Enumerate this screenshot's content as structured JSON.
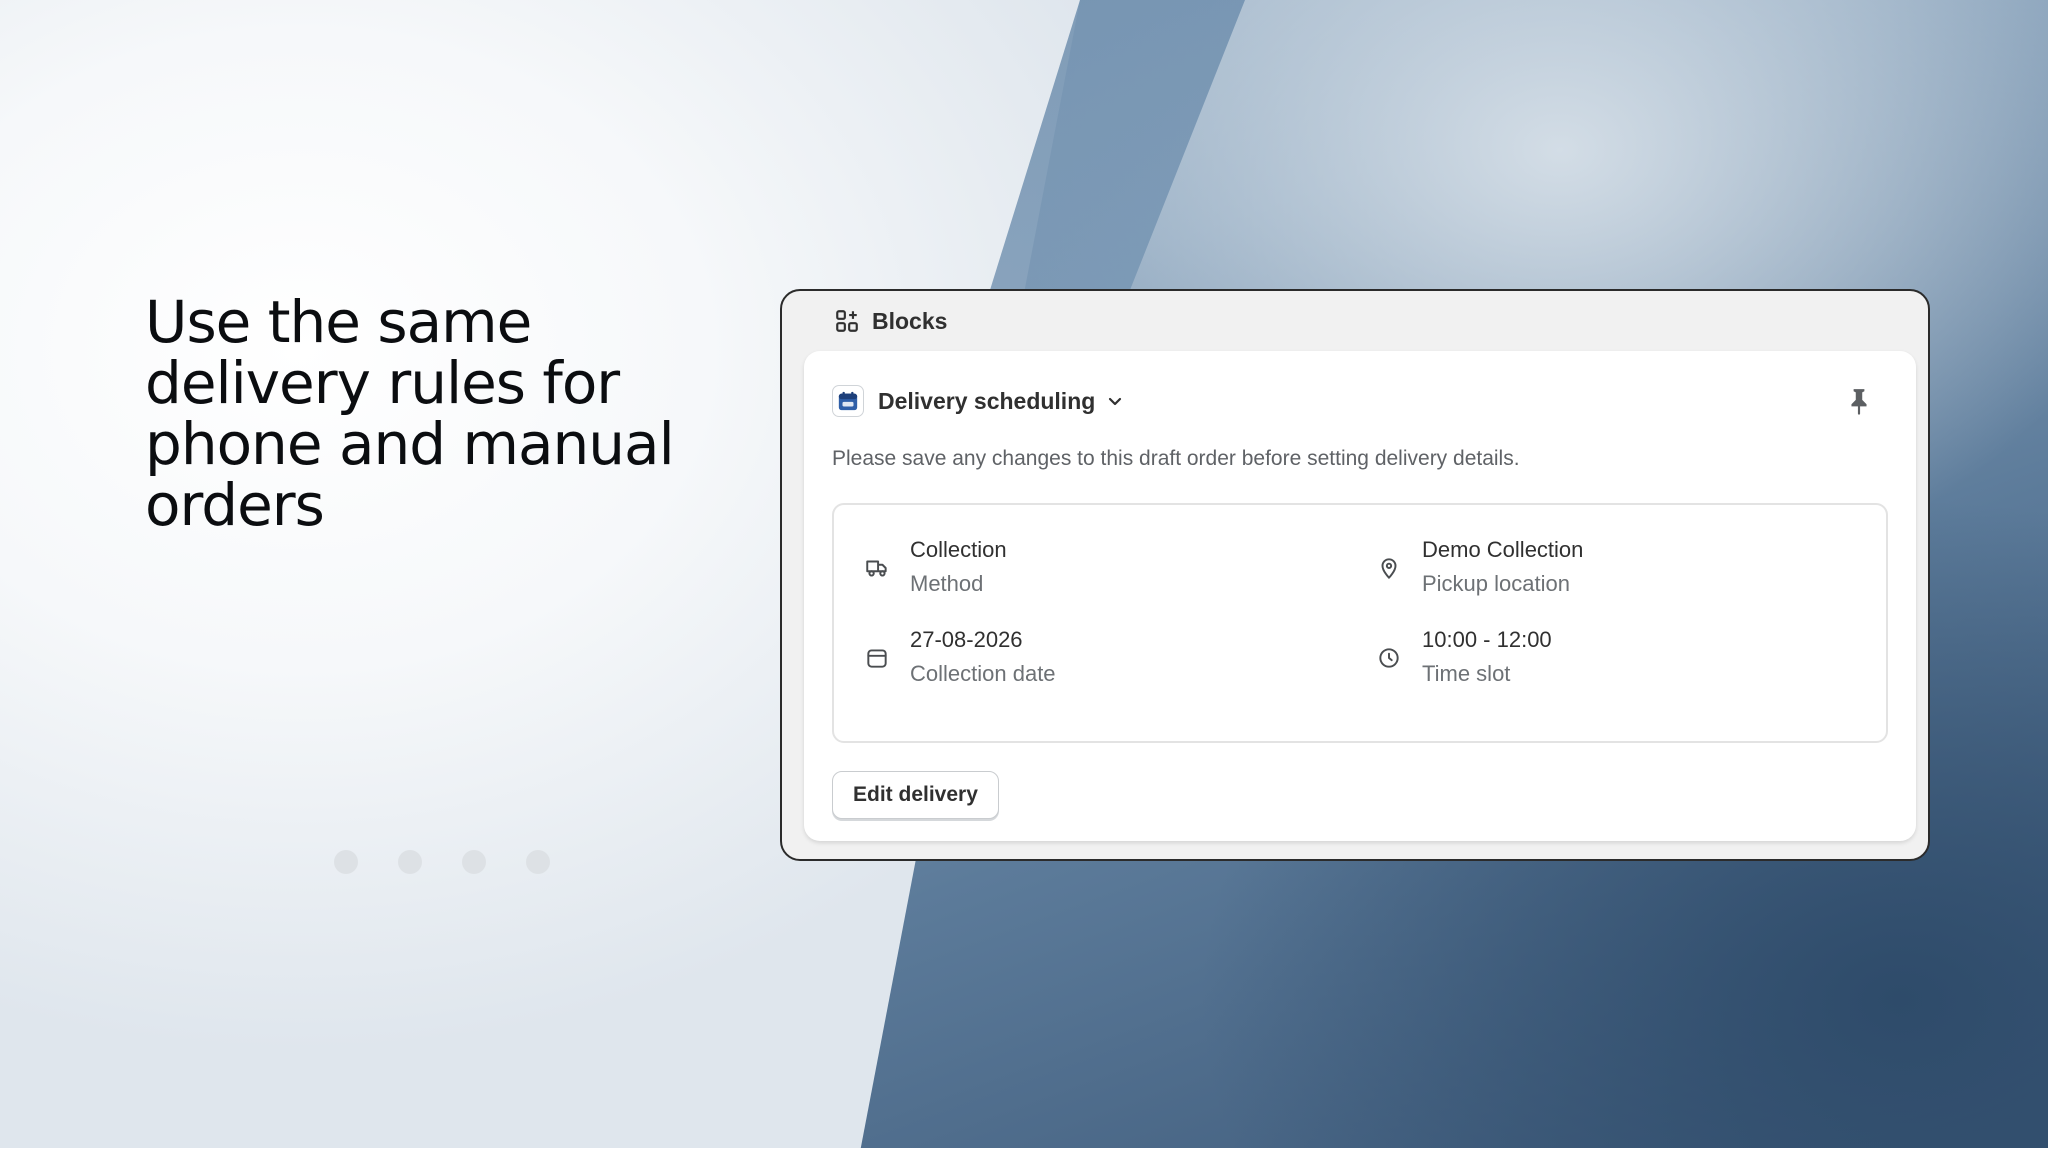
{
  "headline": "Use the same delivery rules for phone and manual orders",
  "card": {
    "header_title": "Blocks",
    "app": {
      "title": "Delivery scheduling",
      "notice": "Please save any changes to this draft order before setting delivery details."
    },
    "details": [
      {
        "icon": "truck-icon",
        "primary": "Collection",
        "secondary": "Method"
      },
      {
        "icon": "location-pin-icon",
        "primary": "Demo Collection",
        "secondary": "Pickup location"
      },
      {
        "icon": "calendar-icon",
        "primary": "27-08-2026",
        "secondary": "Collection date"
      },
      {
        "icon": "clock-icon",
        "primary": "10:00 - 12:00",
        "secondary": "Time slot"
      }
    ],
    "edit_button": "Edit delivery"
  },
  "carousel": {
    "dot_count": 4
  },
  "colors": {
    "headline": "#0b0d10",
    "text_primary": "#303030",
    "text_secondary": "#6d7175",
    "card_bg": "#f1f1f1",
    "panel_bg": "#ffffff"
  }
}
